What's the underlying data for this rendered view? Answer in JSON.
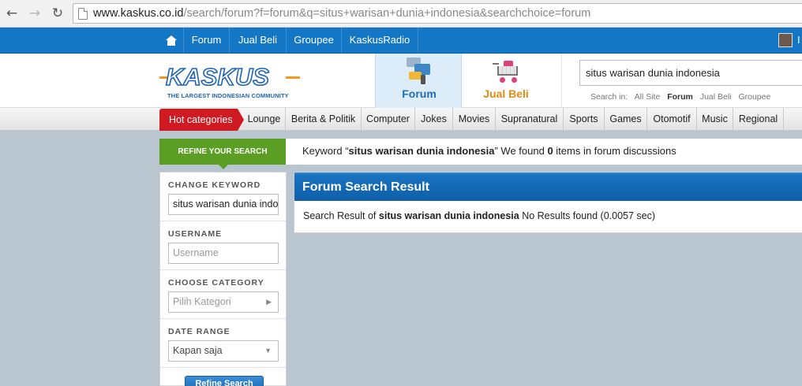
{
  "browser": {
    "url_host": "www.kaskus.co.id",
    "url_rest": "/search/forum?f=forum&q=situs+warisan+dunia+indonesia&searchchoice=forum",
    "back_icon": "arrow-left",
    "forward_icon": "arrow-right",
    "reload_icon": "reload"
  },
  "topnav": {
    "items": [
      "Forum",
      "Jual Beli",
      "Groupee",
      "KaskusRadio"
    ],
    "user_initial": "I"
  },
  "logo": {
    "word": "KASKUS",
    "tagline": "THE LARGEST INDONESIAN COMMUNITY"
  },
  "tabs": {
    "forum": "Forum",
    "jual_beli": "Jual Beli"
  },
  "search": {
    "value": "situs warisan dunia indonesia",
    "search_in_label": "Search in:",
    "scopes": [
      "All Site",
      "Forum",
      "Jual Beli",
      "Groupee"
    ],
    "selected_scope": "Forum"
  },
  "categories": {
    "hot": "Hot categories",
    "items": [
      "Lounge",
      "Berita & Politik",
      "Computer",
      "Jokes",
      "Movies",
      "Supranatural",
      "Sports",
      "Games",
      "Otomotif",
      "Music",
      "Regional"
    ]
  },
  "refine": {
    "tab_label": "REFINE YOUR SEARCH",
    "kw_prefix": "Keyword “",
    "kw_query": "situs warisan dunia indonesia",
    "kw_mid": "” We found ",
    "kw_count": "0",
    "kw_suffix": " items in forum discussions"
  },
  "sidebar": {
    "change_keyword_label": "CHANGE KEYWORD",
    "keyword_value": "situs warisan dunia indonesia",
    "username_label": "USERNAME",
    "username_placeholder": "Username",
    "category_label": "CHOOSE CATEGORY",
    "category_value": "Pilih Kategori",
    "date_label": "DATE RANGE",
    "date_value": "Kapan saja",
    "refine_button": "Refine Search"
  },
  "results": {
    "title": "Forum Search Result",
    "prefix": "Search Result of ",
    "query": "situs warisan dunia indonesia",
    "suffix": " No Results found (0.0057 sec)"
  },
  "colors": {
    "topnav": "#1477c6",
    "hot": "#cf1a22",
    "refine": "#5b9e24",
    "accent": "#e58a10"
  }
}
